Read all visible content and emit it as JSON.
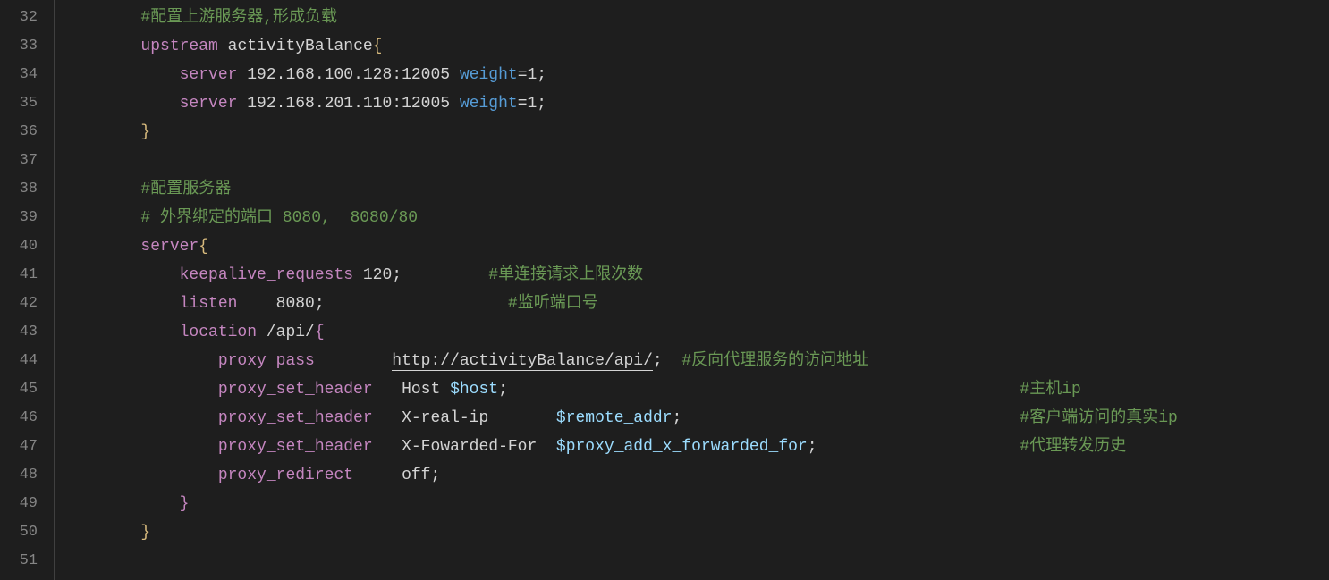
{
  "lineStart": 32,
  "lines": [
    {
      "indent": 2,
      "tokens": [
        [
          "comment",
          "#配置上游服务器,形成负载"
        ]
      ]
    },
    {
      "indent": 2,
      "tokens": [
        [
          "keyword",
          "upstream "
        ],
        [
          "text",
          "activityBalance"
        ],
        [
          "yellow",
          "{"
        ]
      ]
    },
    {
      "indent": 3,
      "tokens": [
        [
          "keyword",
          "server "
        ],
        [
          "text",
          "192.168.100.128:12005 "
        ],
        [
          "blue",
          "weight"
        ],
        [
          "text",
          "=1;"
        ]
      ]
    },
    {
      "indent": 3,
      "tokens": [
        [
          "keyword",
          "server "
        ],
        [
          "text",
          "192.168.201.110:12005 "
        ],
        [
          "blue",
          "weight"
        ],
        [
          "text",
          "=1;"
        ]
      ]
    },
    {
      "indent": 2,
      "tokens": [
        [
          "yellow",
          "}"
        ]
      ]
    },
    {
      "indent": 0,
      "tokens": []
    },
    {
      "indent": 2,
      "tokens": [
        [
          "comment",
          "#配置服务器"
        ]
      ]
    },
    {
      "indent": 2,
      "tokens": [
        [
          "comment",
          "# 外界绑定的端口 8080,  8080/80"
        ]
      ]
    },
    {
      "indent": 2,
      "tokens": [
        [
          "keyword",
          "server"
        ],
        [
          "yellow",
          "{"
        ]
      ]
    },
    {
      "indent": 3,
      "tokens": [
        [
          "keyword",
          "keepalive_requests "
        ],
        [
          "text",
          "120;         "
        ],
        [
          "comment",
          "#单连接请求上限次数"
        ]
      ]
    },
    {
      "indent": 3,
      "tokens": [
        [
          "keyword",
          "listen    "
        ],
        [
          "text",
          "8080;                   "
        ],
        [
          "comment",
          "#监听端口号"
        ]
      ]
    },
    {
      "indent": 3,
      "tokens": [
        [
          "keyword",
          "location "
        ],
        [
          "text",
          "/api/"
        ],
        [
          "keyword",
          "{"
        ]
      ]
    },
    {
      "indent": 4,
      "tokens": [
        [
          "keyword",
          "proxy_pass        "
        ],
        [
          "urltext",
          "http://activityBalance/api/"
        ],
        [
          "text",
          ";  "
        ],
        [
          "comment",
          "#反向代理服务的访问地址"
        ]
      ]
    },
    {
      "indent": 4,
      "tokens": [
        [
          "keyword",
          "proxy_set_header   "
        ],
        [
          "text",
          "Host "
        ],
        [
          "var",
          "$host"
        ],
        [
          "text",
          ";                                                     "
        ],
        [
          "comment",
          "#主机ip"
        ]
      ]
    },
    {
      "indent": 4,
      "tokens": [
        [
          "keyword",
          "proxy_set_header   "
        ],
        [
          "text",
          "X-real-ip       "
        ],
        [
          "var",
          "$remote_addr"
        ],
        [
          "text",
          ";                                   "
        ],
        [
          "comment",
          "#客户端访问的真实ip"
        ]
      ]
    },
    {
      "indent": 4,
      "tokens": [
        [
          "keyword",
          "proxy_set_header   "
        ],
        [
          "text",
          "X-Fowarded-For  "
        ],
        [
          "var",
          "$proxy_add_x_forwarded_for"
        ],
        [
          "text",
          ";                     "
        ],
        [
          "comment",
          "#代理转发历史"
        ]
      ]
    },
    {
      "indent": 4,
      "tokens": [
        [
          "keyword",
          "proxy_redirect     "
        ],
        [
          "text",
          "off;"
        ]
      ]
    },
    {
      "indent": 3,
      "tokens": [
        [
          "keyword",
          "}"
        ]
      ]
    },
    {
      "indent": 2,
      "tokens": [
        [
          "yellow",
          "}"
        ]
      ]
    },
    {
      "indent": 0,
      "tokens": []
    }
  ],
  "indentUnit": "    "
}
